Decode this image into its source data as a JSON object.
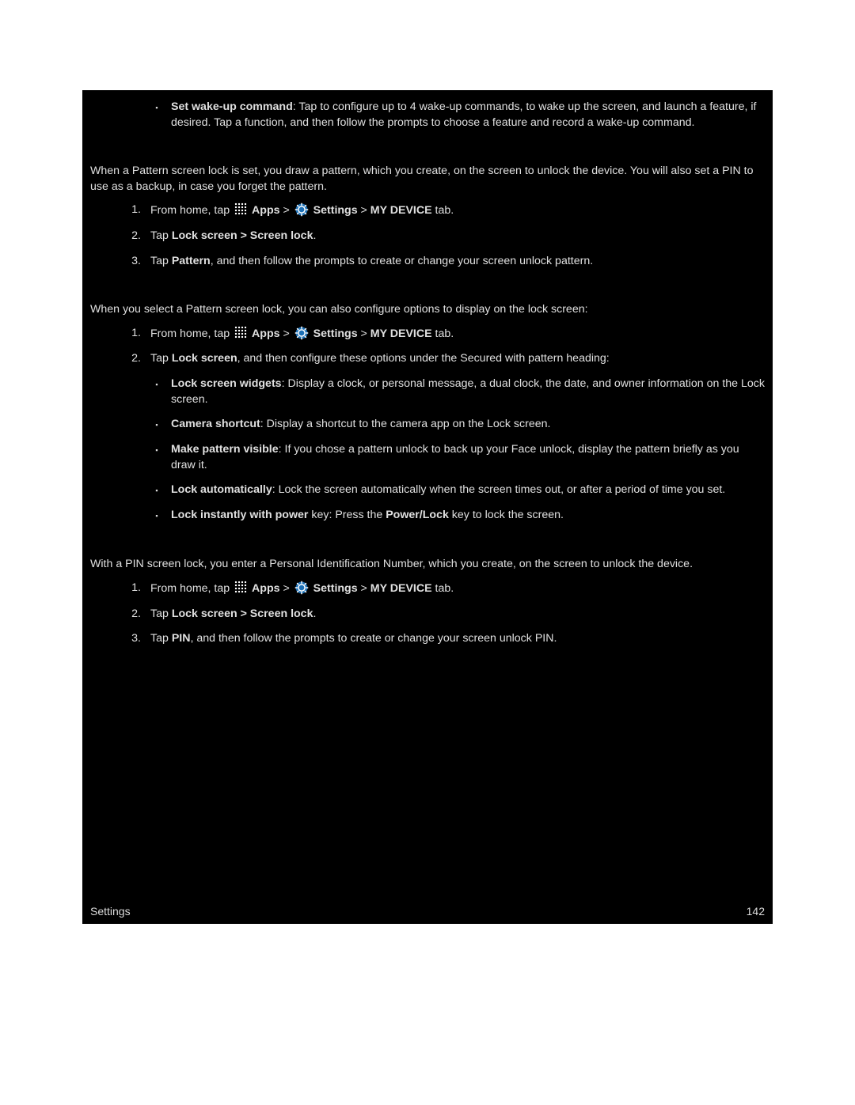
{
  "top_bullet": {
    "label": "Set wake-up command",
    "text": ": Tap to configure up to 4 wake-up commands, to wake up the screen, and launch a feature, if desired. Tap a function, and then follow the prompts to choose a feature and record a wake-up command."
  },
  "pattern": {
    "intro": "When a Pattern screen lock is set, you draw a pattern, which you create, on the screen to unlock the device. You will also set a PIN to use as a backup, in case you forget the pattern.",
    "step1_pre": "From home, tap ",
    "apps_label": "Apps",
    "gt1": " > ",
    "settings_label": "Settings",
    "step1_post": " > ",
    "mydevice_label": "MY DEVICE",
    "tab_text": " tab.",
    "step2_pre": "Tap ",
    "step2_bold": "Lock screen > Screen lock",
    "step2_post": ".",
    "step3_pre": "Tap ",
    "step3_bold": "Pattern",
    "step3_post": ", and then follow the prompts to create or change your screen unlock pattern."
  },
  "pattern_options": {
    "intro": "When you select a Pattern screen lock, you can also configure options to display on the lock screen:",
    "step2_pre": "Tap ",
    "step2_bold": "Lock screen",
    "step2_post": ", and then configure these options under the Secured with pattern heading:",
    "b1_label": "Lock screen widgets",
    "b1_text": ": Display a clock, or personal message, a dual clock, the date, and owner information on the Lock screen.",
    "b2_label": "Camera shortcut",
    "b2_text": ": Display a shortcut to the camera app on the Lock screen.",
    "b3_label": "Make pattern visible",
    "b3_text": ": If you chose a pattern unlock to back up your Face unlock, display the pattern briefly as you draw it.",
    "b4_label": "Lock automatically",
    "b4_text": ": Lock the screen automatically when the screen times out, or after a period of time you set.",
    "b5_label": "Lock instantly with power",
    "b5_mid": " key: Press the ",
    "b5_bold2": "Power/Lock",
    "b5_end": " key to lock the screen."
  },
  "pin": {
    "intro": "With a PIN screen lock, you enter a Personal Identification Number, which you create, on the screen to unlock the device.",
    "step3_pre": "Tap ",
    "step3_bold": "PIN",
    "step3_post": ", and then follow the prompts to create or change your screen unlock PIN."
  },
  "nums": {
    "n1": "1.",
    "n2": "2.",
    "n3": "3."
  },
  "footer": {
    "left": "Settings",
    "right": "142"
  }
}
